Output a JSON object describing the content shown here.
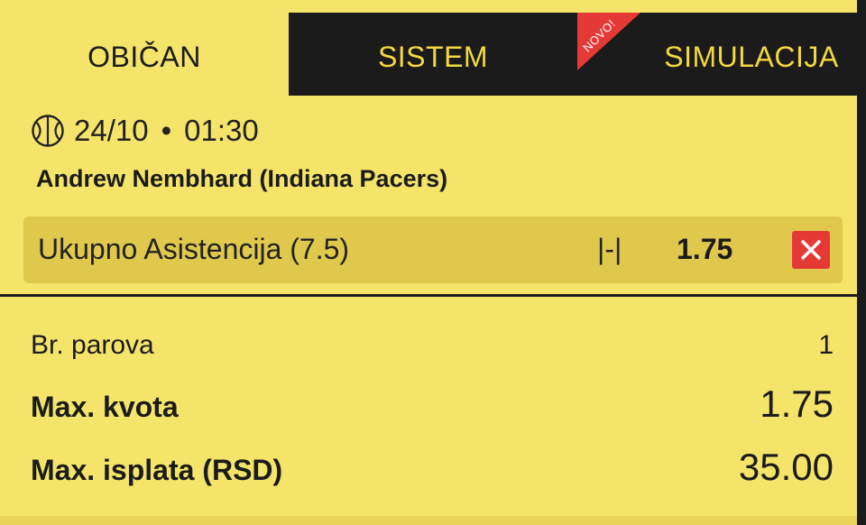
{
  "tabs": [
    {
      "label": "OBIČAN",
      "active": true
    },
    {
      "label": "SISTEM",
      "active": false
    },
    {
      "label": "SIMULACIJA",
      "active": false,
      "badge": "NOVO!"
    }
  ],
  "event": {
    "sport_icon": "basketball-icon",
    "date": "24/10",
    "separator": "•",
    "time": "01:30",
    "player": "Andrew Nembhard (Indiana Pacers)"
  },
  "selection": {
    "market": "Ukupno Asistencija (7.5)",
    "lock_symbol": "|-|",
    "odds": "1.75",
    "remove_icon": "close-icon"
  },
  "summary": {
    "pairs_label": "Br. parova",
    "pairs_value": "1",
    "max_odds_label": "Max. kvota",
    "max_odds_value": "1.75",
    "max_payout_label": "Max. isplata (RSD)",
    "max_payout_value": "35.00"
  },
  "colors": {
    "background": "#f5e46a",
    "dark": "#1b1b1b",
    "tab_text": "#f3d83e",
    "selection_bg": "#e0c84d",
    "accent_red": "#e53935"
  }
}
